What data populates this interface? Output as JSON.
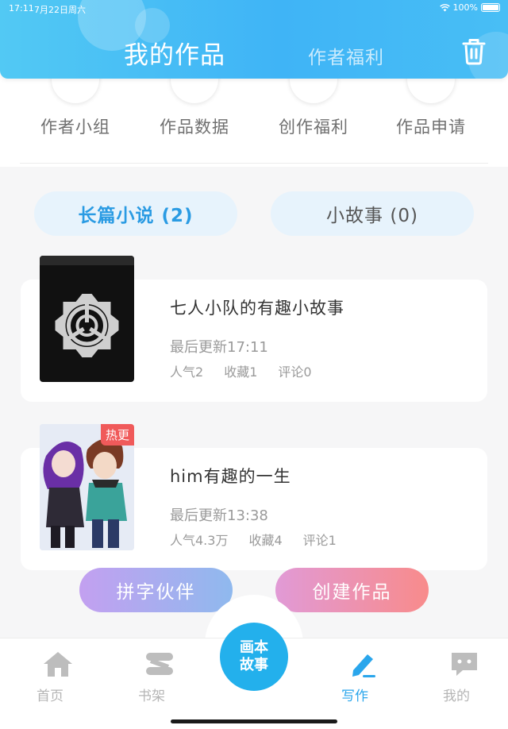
{
  "status_bar": {
    "time": "17:11",
    "date": "7月22日周六",
    "battery": "100%"
  },
  "header": {
    "active_tab": "我的作品",
    "inactive_tab": "作者福利",
    "trash_icon": "trash-icon"
  },
  "quick_actions": [
    {
      "label": "作者小组",
      "icon": "group-icon"
    },
    {
      "label": "作品数据",
      "icon": "data-icon"
    },
    {
      "label": "创作福利",
      "icon": "gift-icon"
    },
    {
      "label": "作品申请",
      "icon": "apply-icon"
    }
  ],
  "categories": [
    {
      "label": "长篇小说 (2)",
      "active": true
    },
    {
      "label": "小故事 (0)",
      "active": false
    }
  ],
  "works": [
    {
      "title": "七人小队的有趣小故事",
      "updated": "最后更新17:11",
      "popularity": "人气2",
      "favorites": "收藏1",
      "comments": "评论0",
      "badge": ""
    },
    {
      "title": "him有趣的一生",
      "updated": "最后更新13:38",
      "popularity": "人气4.3万",
      "favorites": "收藏4",
      "comments": "评论1",
      "badge": "热更"
    }
  ],
  "buttons": {
    "partner": "拼字伙伴",
    "create": "创建作品"
  },
  "nav": {
    "home": "首页",
    "shelf": "书架",
    "center_line1": "画本",
    "center_line2": "故事",
    "write": "写作",
    "mine": "我的"
  },
  "colors": {
    "accent": "#2aa6ec",
    "header": "#48bef5",
    "hot_badge": "#f05a5a"
  }
}
